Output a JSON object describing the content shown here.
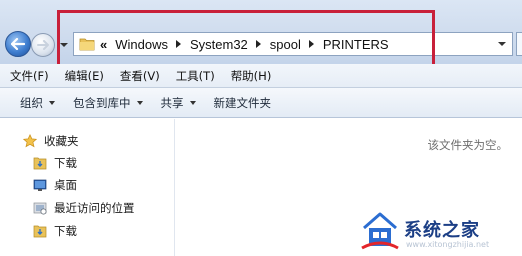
{
  "address_bar": {
    "overflow_glyph": "«",
    "crumbs": [
      "Windows",
      "System32",
      "spool",
      "PRINTERS"
    ]
  },
  "menu": [
    "文件(F)",
    "编辑(E)",
    "查看(V)",
    "工具(T)",
    "帮助(H)"
  ],
  "toolbar": {
    "organize": "组织",
    "include_in_library": "包含到库中",
    "share": "共享",
    "new_folder": "新建文件夹"
  },
  "nav_pane": {
    "favorites": "收藏夹",
    "downloads": "下载",
    "desktop": "桌面",
    "recent_places": "最近访问的位置",
    "downloads_2": "下载"
  },
  "content": {
    "empty_message": "该文件夹为空。"
  },
  "watermark": {
    "brand": "系统之家",
    "url": "www.xitongzhijia.net"
  },
  "colors": {
    "highlight": "#c8203a",
    "chrome_blue": "#cfdcee",
    "folder_yellow": "#e9c25a",
    "brand_blue": "#1c3f86"
  },
  "icons": [
    "back-arrow-icon",
    "forward-arrow-icon",
    "folder-icon",
    "star-icon",
    "desktop-icon",
    "recent-places-icon",
    "chevron-down-icon"
  ]
}
